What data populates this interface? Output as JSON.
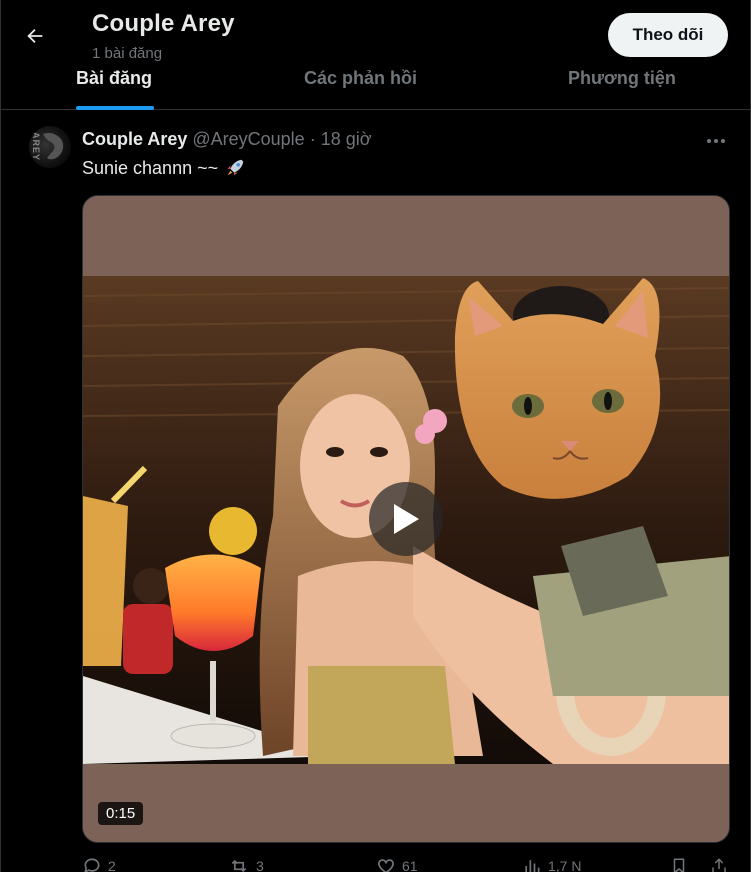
{
  "header": {
    "title": "Couple Arey",
    "subtitle": "1 bài đăng",
    "follow_label": "Theo dõi"
  },
  "tabs": [
    {
      "label": "Bài đăng",
      "active": true
    },
    {
      "label": "Các phản hồi",
      "active": false
    },
    {
      "label": "Phương tiện",
      "active": false
    }
  ],
  "post": {
    "name": "Couple Arey",
    "handle": "@AreyCouple",
    "separator": "·",
    "time": "18 giờ",
    "text": "Sunie channn ~~",
    "emoji": "rocket-icon",
    "avatar_text": "AREY",
    "video_duration": "0:15",
    "counts": {
      "replies": "2",
      "reposts": "3",
      "likes": "61",
      "views": "1,7 N"
    }
  },
  "colors": {
    "background": "#000000",
    "accent": "#1d9bf0",
    "text": "#e7e9ea",
    "muted": "#71767b",
    "follow_button_bg": "#eff3f4",
    "media_frame": "#7c6257"
  }
}
